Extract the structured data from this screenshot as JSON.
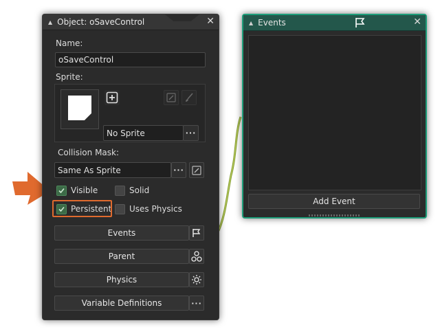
{
  "object_panel": {
    "title": "Object: oSaveControl",
    "name_label": "Name:",
    "name_value": "oSaveControl",
    "sprite_label": "Sprite:",
    "sprite_value": "No Sprite",
    "collision_label": "Collision Mask:",
    "collision_value": "Same As Sprite",
    "checkboxes": {
      "visible": {
        "label": "Visible",
        "checked": true
      },
      "solid": {
        "label": "Solid",
        "checked": false
      },
      "persistent": {
        "label": "Persistent",
        "checked": true
      },
      "uses_physics": {
        "label": "Uses Physics",
        "checked": false
      }
    },
    "buttons": {
      "events": "Events",
      "parent": "Parent",
      "physics": "Physics",
      "variable_definitions": "Variable Definitions"
    }
  },
  "events_panel": {
    "title": "Events",
    "add_event": "Add Event"
  },
  "colors": {
    "panel_bg": "#2b2b2b",
    "events_accent": "#1e9e7a",
    "highlight": "#e06a2e",
    "checkbox_checked": "#3c6b47"
  }
}
